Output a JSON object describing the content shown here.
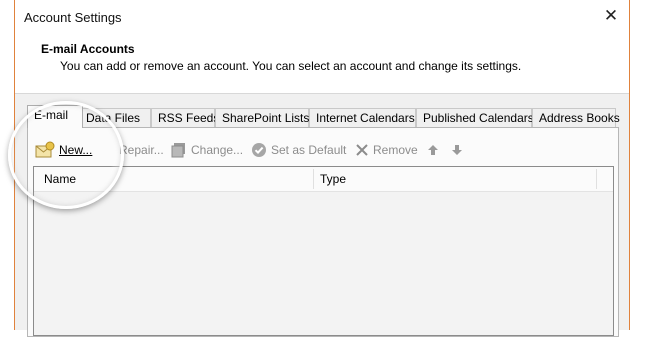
{
  "window": {
    "title": "Account Settings"
  },
  "header": {
    "title": "E-mail Accounts",
    "description": "You can add or remove an account. You can select an account and change its settings."
  },
  "tabs": [
    {
      "label": "E-mail",
      "active": true
    },
    {
      "label": "Data Files"
    },
    {
      "label": "RSS Feeds"
    },
    {
      "label": "SharePoint Lists"
    },
    {
      "label": "Internet Calendars"
    },
    {
      "label": "Published Calendars"
    },
    {
      "label": "Address Books"
    }
  ],
  "toolbar": {
    "new": "New...",
    "repair": "Repair...",
    "change": "Change...",
    "set_default": "Set as Default",
    "remove": "Remove"
  },
  "list": {
    "col_name": "Name",
    "col_type": "Type"
  }
}
